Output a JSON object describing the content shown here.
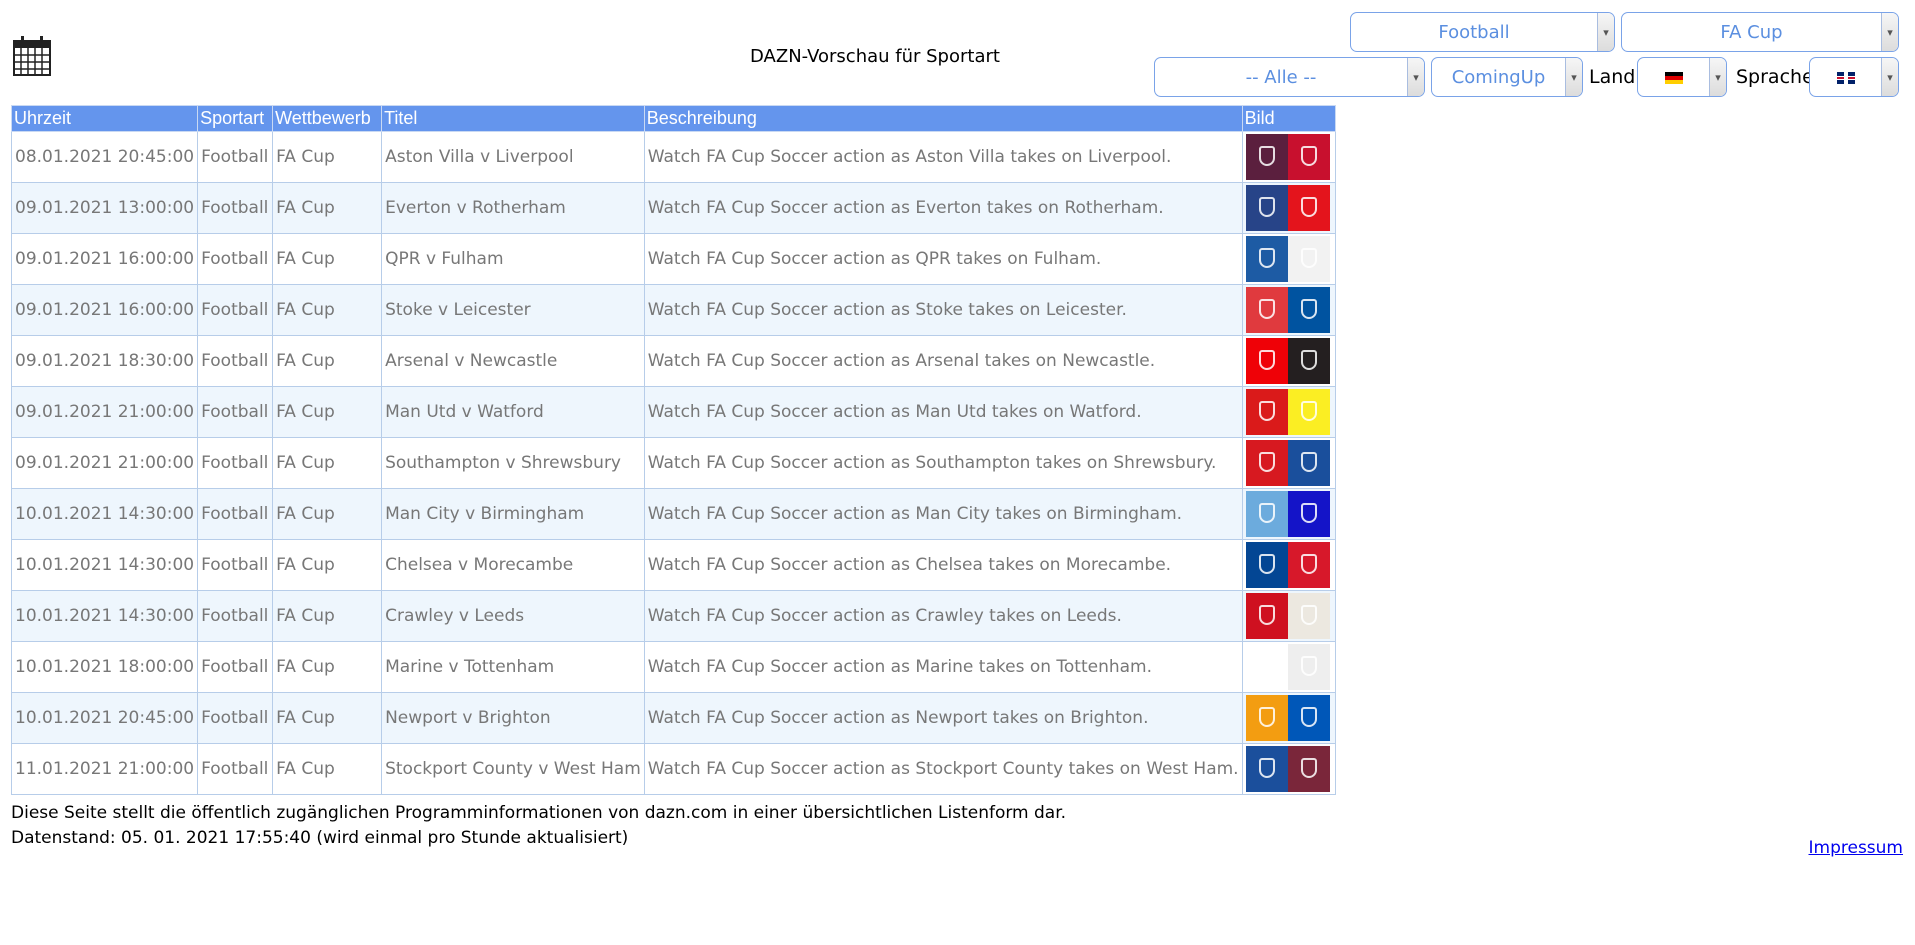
{
  "title": "DAZN-Vorschau für Sportart",
  "filters": {
    "sport": "Football",
    "competition": "FA Cup",
    "category": "-- Alle --",
    "mode": "ComingUp",
    "land_label": "Land:",
    "sprache_label": "Sprache:"
  },
  "colors": {
    "header_bg": "#6495ed",
    "alt_row": "#eef6fd",
    "select_text": "#5b8fe0"
  },
  "table": {
    "headers": [
      "Uhrzeit",
      "Sportart",
      "Wettbewerb",
      "Titel",
      "Beschreibung",
      "Bild"
    ],
    "rows": [
      {
        "time": "08.01.2021 20:45:00",
        "sport": "Football",
        "comp": "FA Cup",
        "title": "Aston Villa v Liverpool",
        "desc": "Watch FA Cup Soccer action as Aston Villa takes on Liverpool.",
        "c1": "#5b1f3e",
        "c2": "#c8102e"
      },
      {
        "time": "09.01.2021 13:00:00",
        "sport": "Football",
        "comp": "FA Cup",
        "title": "Everton v Rotherham",
        "desc": "Watch FA Cup Soccer action as Everton takes on Rotherham.",
        "c1": "#274488",
        "c2": "#e4141c"
      },
      {
        "time": "09.01.2021 16:00:00",
        "sport": "Football",
        "comp": "FA Cup",
        "title": "QPR v Fulham",
        "desc": "Watch FA Cup Soccer action as QPR takes on Fulham.",
        "c1": "#1d5ba4",
        "c2": "#f2f2f2"
      },
      {
        "time": "09.01.2021 16:00:00",
        "sport": "Football",
        "comp": "FA Cup",
        "title": "Stoke v Leicester",
        "desc": "Watch FA Cup Soccer action as Stoke takes on Leicester.",
        "c1": "#e03a3e",
        "c2": "#0053a0"
      },
      {
        "time": "09.01.2021 18:30:00",
        "sport": "Football",
        "comp": "FA Cup",
        "title": "Arsenal v Newcastle",
        "desc": "Watch FA Cup Soccer action as Arsenal takes on Newcastle.",
        "c1": "#ef0107",
        "c2": "#241f20"
      },
      {
        "time": "09.01.2021 21:00:00",
        "sport": "Football",
        "comp": "FA Cup",
        "title": "Man Utd v Watford",
        "desc": "Watch FA Cup Soccer action as Man Utd takes on Watford.",
        "c1": "#da1a1a",
        "c2": "#fbee23"
      },
      {
        "time": "09.01.2021 21:00:00",
        "sport": "Football",
        "comp": "FA Cup",
        "title": "Southampton v Shrewsbury",
        "desc": "Watch FA Cup Soccer action as Southampton takes on Shrewsbury.",
        "c1": "#d71920",
        "c2": "#1a4f9c"
      },
      {
        "time": "10.01.2021 14:30:00",
        "sport": "Football",
        "comp": "FA Cup",
        "title": "Man City v Birmingham",
        "desc": "Watch FA Cup Soccer action as Man City takes on Birmingham.",
        "c1": "#6cabdd",
        "c2": "#1414c8"
      },
      {
        "time": "10.01.2021 14:30:00",
        "sport": "Football",
        "comp": "FA Cup",
        "title": "Chelsea v Morecambe",
        "desc": "Watch FA Cup Soccer action as Chelsea takes on Morecambe.",
        "c1": "#034694",
        "c2": "#d7182a"
      },
      {
        "time": "10.01.2021 14:30:00",
        "sport": "Football",
        "comp": "FA Cup",
        "title": "Crawley v Leeds",
        "desc": "Watch FA Cup Soccer action as Crawley takes on Leeds.",
        "c1": "#cf1020",
        "c2": "#ece8e0"
      },
      {
        "time": "10.01.2021 18:00:00",
        "sport": "Football",
        "comp": "FA Cup",
        "title": "Marine v Tottenham",
        "desc": "Watch FA Cup Soccer action as Marine takes on Tottenham.",
        "c1": "#ffffff",
        "c2": "#eeeeee"
      },
      {
        "time": "10.01.2021 20:45:00",
        "sport": "Football",
        "comp": "FA Cup",
        "title": "Newport v Brighton",
        "desc": "Watch FA Cup Soccer action as Newport takes on Brighton.",
        "c1": "#f39d11",
        "c2": "#0057b8"
      },
      {
        "time": "11.01.2021 21:00:00",
        "sport": "Football",
        "comp": "FA Cup",
        "title": "Stockport County v West Ham",
        "desc": "Watch FA Cup Soccer action as Stockport County takes on West Ham.",
        "c1": "#1b4f9c",
        "c2": "#7a263a"
      }
    ]
  },
  "footer": {
    "line1": "Diese Seite stellt die öffentlich zugänglichen Programminformationen von dazn.com in einer übersichtlichen Listenform dar.",
    "line2": "Datenstand: 05. 01. 2021 17:55:40 (wird einmal pro Stunde aktualisiert)",
    "impressum": "Impressum"
  }
}
